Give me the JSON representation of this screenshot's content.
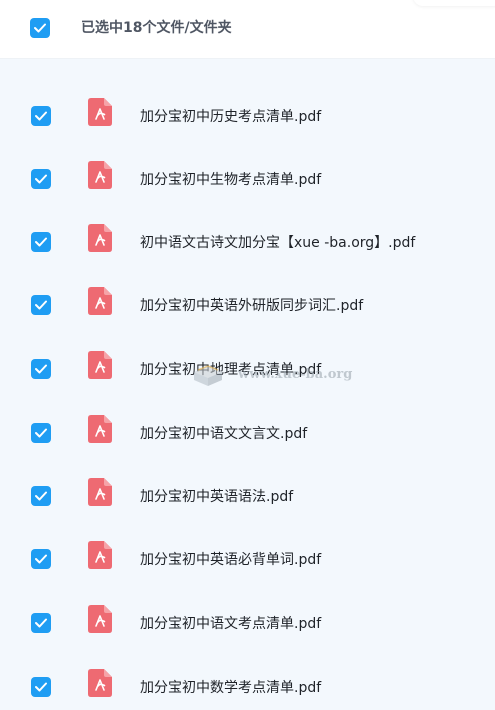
{
  "header": {
    "selection_text": "已选中18个文件/文件夹"
  },
  "files": [
    {
      "name": ""
    },
    {
      "name": "加分宝初中历史考点清单.pdf"
    },
    {
      "name": "加分宝初中生物考点清单.pdf"
    },
    {
      "name": "初中语文古诗文加分宝【xue -ba.org】.pdf"
    },
    {
      "name": "加分宝初中英语外研版同步词汇.pdf"
    },
    {
      "name": "加分宝初中地理考点清单.pdf"
    },
    {
      "name": "加分宝初中语文文言文.pdf"
    },
    {
      "name": "加分宝初中英语语法.pdf"
    },
    {
      "name": "加分宝初中英语必背单词.pdf"
    },
    {
      "name": "加分宝初中语文考点清单.pdf"
    },
    {
      "name": "加分宝初中数学考点清单.pdf"
    }
  ],
  "watermark": {
    "text": "www.xue-ba.org"
  },
  "colors": {
    "checkbox": "#1f9df3",
    "pdf_icon": "#ee6a72",
    "list_background": "#f3f8fd",
    "header_background": "#ffffff"
  },
  "icons": {
    "checkbox": "check-icon",
    "file": "pdf-file-icon"
  }
}
